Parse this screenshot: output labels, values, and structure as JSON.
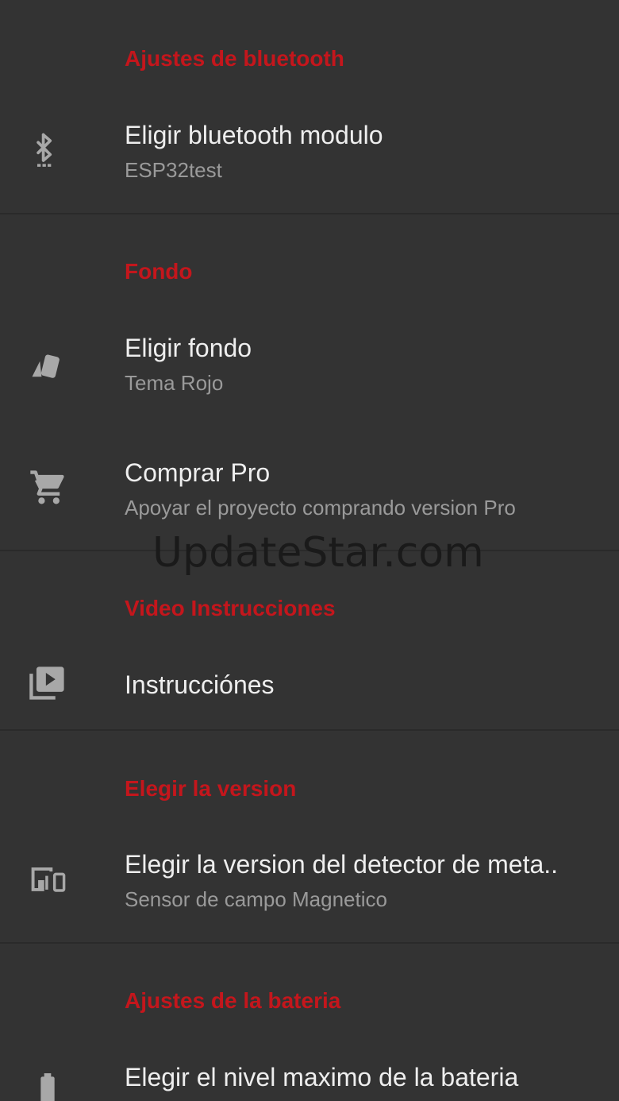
{
  "sections": {
    "bluetooth": {
      "header": "Ajustes de bluetooth",
      "item": {
        "title": "Eligir bluetooth modulo",
        "summary": "ESP32test",
        "icon": "bluetooth-searching-icon"
      }
    },
    "fondo": {
      "header": "Fondo",
      "items": [
        {
          "title": "Eligir fondo",
          "summary": "Tema Rojo",
          "icon": "swatches-icon"
        },
        {
          "title": "Comprar Pro",
          "summary": "Apoyar el proyecto comprando version Pro",
          "icon": "shopping-cart-icon"
        }
      ]
    },
    "video": {
      "header": "Video Instrucciones",
      "item": {
        "title": "Instrucciónes",
        "icon": "video-library-icon"
      }
    },
    "version": {
      "header": "Elegir la version",
      "item": {
        "title": "Elegir la version del detector de meta..",
        "summary": "Sensor de campo Magnetico",
        "icon": "devices-icon"
      }
    },
    "bateria": {
      "header": "Ajustes de la bateria",
      "item": {
        "title": "Elegir el nivel maximo de la bateria",
        "icon": "battery-icon"
      }
    }
  },
  "watermark": "UpdateStar.com",
  "colors": {
    "background": "#333333",
    "accent": "#c4161c",
    "title": "#eeeeee",
    "summary": "#9a9a9a",
    "icon": "#a8a8a8"
  }
}
